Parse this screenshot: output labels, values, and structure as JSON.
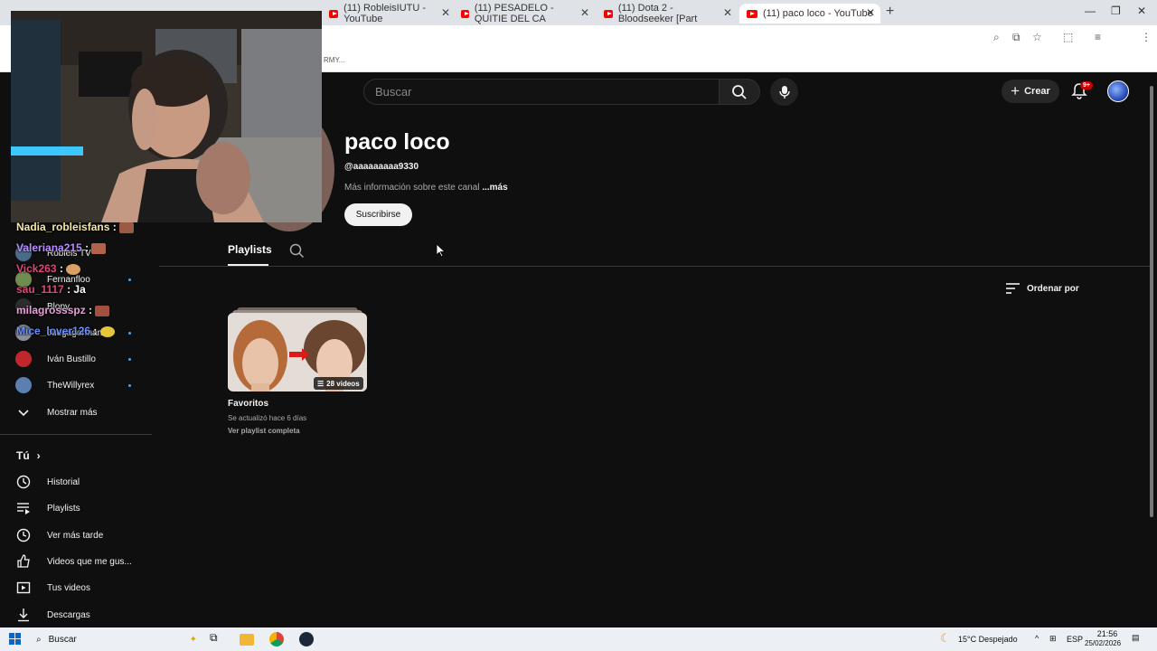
{
  "browser": {
    "tabs": [
      {
        "label": "(11) RobleisIUTU - YouTube"
      },
      {
        "label": "(11) PESADELO - QUITIE DEL CA"
      },
      {
        "label": "(11) Dota 2 - Bloodseeker [Part"
      },
      {
        "label": "(11) paco loco - YouTube"
      }
    ],
    "new_tab": "+",
    "bookmark_fragment": "RMY..."
  },
  "yt_header": {
    "search_placeholder": "Buscar",
    "create_label": "Crear",
    "notifications_badge": "9+"
  },
  "channel": {
    "name": "paco loco",
    "handle": "@aaaaaaaaa9330",
    "about": "Más información sobre este canal",
    "about_more": "...más",
    "subscribe_label": "Suscribirse",
    "tab_playlists": "Playlists",
    "sort_label": "Ordenar por"
  },
  "playlist": {
    "title": "Favoritos",
    "updated": "Se actualizó hace 6 días",
    "view_full": "Ver playlist completa",
    "count": "28 videos"
  },
  "sidebar": {
    "subscriptions": [
      {
        "name": "Robleis TV"
      },
      {
        "name": "Fernanfloo"
      },
      {
        "name": "Blopy"
      },
      {
        "name": "Juegagerman"
      },
      {
        "name": "Iván Bustillo"
      },
      {
        "name": "TheWillyrex"
      }
    ],
    "show_more": "Mostrar más",
    "you_header": "Tú",
    "you_items": [
      {
        "label": "Historial"
      },
      {
        "label": "Playlists"
      },
      {
        "label": "Ver más tarde"
      },
      {
        "label": "Videos que me gus..."
      },
      {
        "label": "Tus videos"
      },
      {
        "label": "Descargas"
      }
    ]
  },
  "chat": [
    {
      "user": "Nadia_robleisfans",
      "sep": " :",
      "msg": "",
      "color": "#f5e7a8"
    },
    {
      "user": "Valeriana215",
      "sep": " :",
      "msg": "",
      "color": "#b98cff"
    },
    {
      "user": "Vick263",
      "sep": " :",
      "msg": "",
      "color": "#e0457b"
    },
    {
      "user": "sau_1117",
      "sep": " :",
      "msg": " Ja",
      "color": "#e0457b"
    },
    {
      "user": "milagrossspz",
      "sep": " :",
      "msg": "",
      "color": "#e8a0d8"
    },
    {
      "user": "Mice_lover126",
      "sep": " :",
      "msg": "",
      "color": "#6b8fff"
    }
  ],
  "taskbar": {
    "search_label": "Buscar",
    "weather": "15°C  Despejado",
    "lang": "ESP",
    "time": "21:56",
    "date": "25/02/2026"
  },
  "colors": {
    "yt_bg": "#0f0f0f",
    "accent_red": "#ff0000",
    "link_blue": "#3ea6ff"
  }
}
